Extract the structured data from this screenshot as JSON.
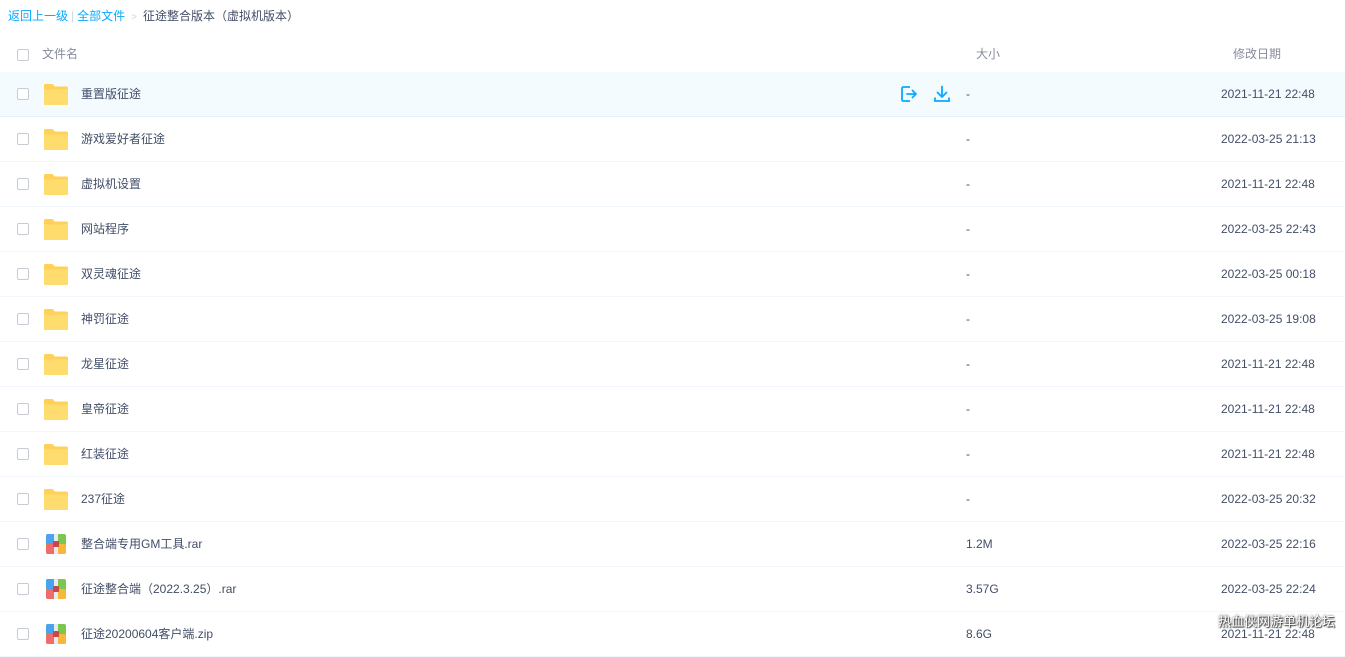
{
  "breadcrumb": {
    "back_label": "返回上一级",
    "separator": "|",
    "all_files_label": "全部文件",
    "arrow": ">",
    "current_label": "征途整合版本（虚拟机版本）"
  },
  "header": {
    "name_label": "文件名",
    "size_label": "大小",
    "date_label": "修改日期"
  },
  "rows": [
    {
      "name": "重置版征途",
      "size": "-",
      "date": "2021-11-21 22:48",
      "type": "folder"
    },
    {
      "name": "游戏爱好者征途",
      "size": "-",
      "date": "2022-03-25 21:13",
      "type": "folder"
    },
    {
      "name": "虚拟机设置",
      "size": "-",
      "date": "2021-11-21 22:48",
      "type": "folder"
    },
    {
      "name": "网站程序",
      "size": "-",
      "date": "2022-03-25 22:43",
      "type": "folder"
    },
    {
      "name": "双灵魂征途",
      "size": "-",
      "date": "2022-03-25 00:18",
      "type": "folder"
    },
    {
      "name": "神罚征途",
      "size": "-",
      "date": "2022-03-25 19:08",
      "type": "folder"
    },
    {
      "name": "龙星征途",
      "size": "-",
      "date": "2021-11-21 22:48",
      "type": "folder"
    },
    {
      "name": "皇帝征途",
      "size": "-",
      "date": "2021-11-21 22:48",
      "type": "folder"
    },
    {
      "name": "红装征途",
      "size": "-",
      "date": "2021-11-21 22:48",
      "type": "folder"
    },
    {
      "name": "237征途",
      "size": "-",
      "date": "2022-03-25 20:32",
      "type": "folder"
    },
    {
      "name": "整合端专用GM工具.rar",
      "size": "1.2M",
      "date": "2022-03-25 22:16",
      "type": "archive"
    },
    {
      "name": "征途整合端（2022.3.25）.rar",
      "size": "3.57G",
      "date": "2022-03-25 22:24",
      "type": "archive"
    },
    {
      "name": "征途20200604客户端.zip",
      "size": "8.6G",
      "date": "2021-11-21 22:48",
      "type": "archive"
    }
  ],
  "row_actions": {
    "share_icon": "share-icon",
    "download_icon": "download-icon"
  },
  "watermark": "热血侠网游单机论坛",
  "colors": {
    "link": "#09aaff",
    "folder": "#ffd257",
    "hover_row": "#f4fbff"
  }
}
